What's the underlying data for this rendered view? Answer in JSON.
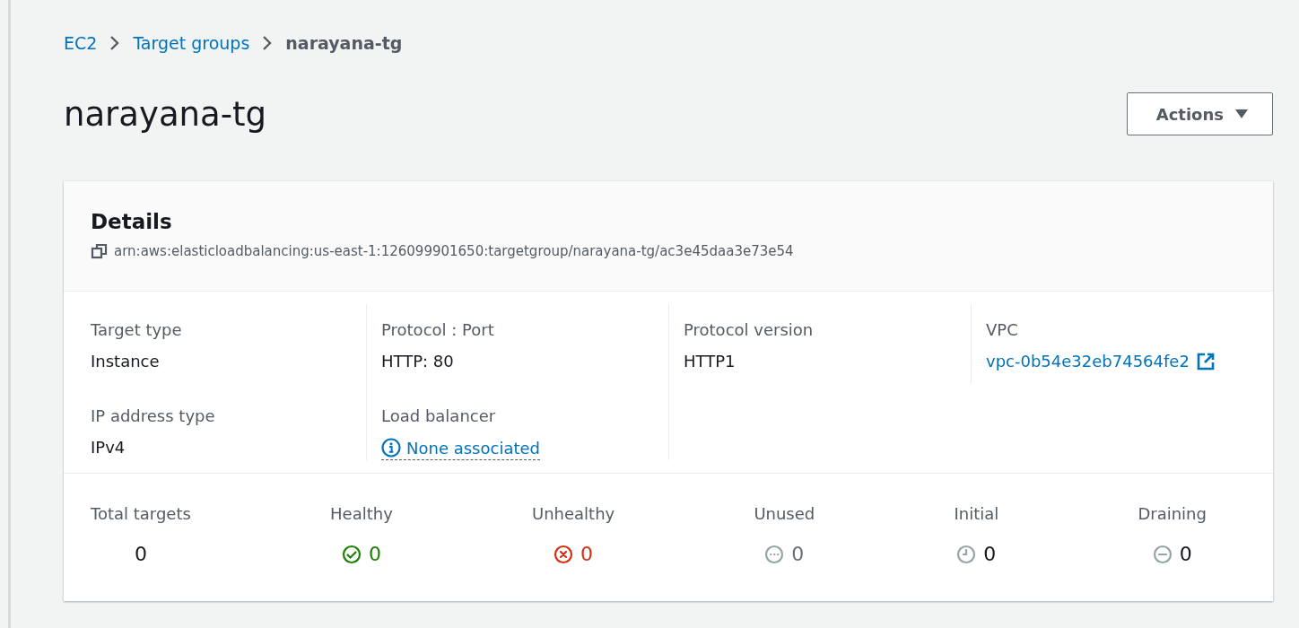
{
  "breadcrumbs": [
    {
      "label": "EC2",
      "kind": "link"
    },
    {
      "label": "Target groups",
      "kind": "link"
    },
    {
      "label": "narayana-tg",
      "kind": "current"
    }
  ],
  "title": "narayana-tg",
  "actions_button": {
    "label": "Actions"
  },
  "details": {
    "title": "Details",
    "arn": "arn:aws:elasticloadbalancing:us-east-1:126099901650:targetgroup/narayana-tg/ac3e45daa3e73e54",
    "columns": [
      {
        "fields": [
          {
            "label": "Target type",
            "value": "Instance",
            "kind": "text"
          },
          {
            "label": "IP address type",
            "value": "IPv4",
            "kind": "text"
          }
        ]
      },
      {
        "fields": [
          {
            "label": "Protocol : Port",
            "value": "HTTP: 80",
            "kind": "text"
          },
          {
            "label": "Load balancer",
            "value": "None associated",
            "kind": "info"
          }
        ]
      },
      {
        "fields": [
          {
            "label": "Protocol version",
            "value": "HTTP1",
            "kind": "text"
          }
        ]
      },
      {
        "fields": [
          {
            "label": "VPC",
            "value": "vpc-0b54e32eb74564fe2",
            "kind": "external"
          }
        ]
      }
    ],
    "stats": [
      {
        "label": "Total targets",
        "value": "0",
        "kind": "total"
      },
      {
        "label": "Healthy",
        "value": "0",
        "kind": "healthy"
      },
      {
        "label": "Unhealthy",
        "value": "0",
        "kind": "unhealthy"
      },
      {
        "label": "Unused",
        "value": "0",
        "kind": "unused"
      },
      {
        "label": "Initial",
        "value": "0",
        "kind": "initial"
      },
      {
        "label": "Draining",
        "value": "0",
        "kind": "draining"
      }
    ]
  }
}
